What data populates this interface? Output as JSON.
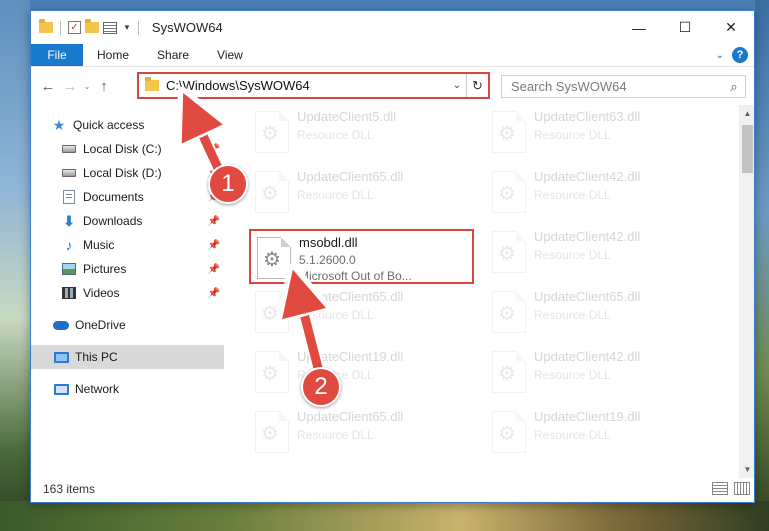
{
  "window": {
    "title": "SysWOW64",
    "controls": {
      "minimize": "—",
      "maximize": "☐",
      "close": "✕"
    }
  },
  "ribbon": {
    "tabs": [
      "File",
      "Home",
      "Share",
      "View"
    ],
    "help": "?"
  },
  "address": {
    "path": "C:\\Windows\\SysWOW64",
    "search_placeholder": "Search SysWOW64"
  },
  "sidebar": {
    "items": [
      {
        "label": "Quick access",
        "icon": "star-icon",
        "pinned": false
      },
      {
        "label": "Local Disk (C:)",
        "icon": "drive-icon",
        "pinned": true
      },
      {
        "label": "Local Disk (D:)",
        "icon": "drive-icon",
        "pinned": true
      },
      {
        "label": "Documents",
        "icon": "documents-icon",
        "pinned": true
      },
      {
        "label": "Downloads",
        "icon": "download-icon",
        "pinned": true
      },
      {
        "label": "Music",
        "icon": "music-icon",
        "pinned": true
      },
      {
        "label": "Pictures",
        "icon": "pictures-icon",
        "pinned": true
      },
      {
        "label": "Videos",
        "icon": "videos-icon",
        "pinned": true
      },
      {
        "label": "OneDrive",
        "icon": "onedrive-icon",
        "pinned": false
      },
      {
        "label": "This PC",
        "icon": "pc-icon",
        "pinned": false
      },
      {
        "label": "Network",
        "icon": "network-icon",
        "pinned": false
      }
    ]
  },
  "files": {
    "left": [
      {
        "name": "UpdateClient5.dll",
        "sub": "Resource DLL"
      },
      {
        "name": "UpdateClient65.dll",
        "sub": "Resource DLL"
      },
      {
        "name": "msobdl.dll",
        "sub": "5.1.2600.0",
        "sub2": "Microsoft Out of Bo..."
      },
      {
        "name": "UpdateClient65.dll",
        "sub": "Resource DLL"
      },
      {
        "name": "UpdateClient19.dll",
        "sub": "Resource DLL"
      },
      {
        "name": "UpdateClient65.dll",
        "sub": "Resource DLL"
      }
    ],
    "right": [
      {
        "name": "UpdateClient63.dll",
        "sub": "Resource DLL"
      },
      {
        "name": "UpdateClient42.dll",
        "sub": "Resource DLL"
      },
      {
        "name": "UpdateClient42.dll",
        "sub": "Resource DLL"
      },
      {
        "name": "UpdateClient65.dll",
        "sub": "Resource DLL"
      },
      {
        "name": "UpdateClient42.dll",
        "sub": "Resource DLL"
      },
      {
        "name": "UpdateClient19.dll",
        "sub": "Resource DLL"
      }
    ]
  },
  "status": {
    "count": "163 items"
  },
  "annotations": {
    "step1": "1",
    "step2": "2",
    "color": "#e14a40"
  }
}
